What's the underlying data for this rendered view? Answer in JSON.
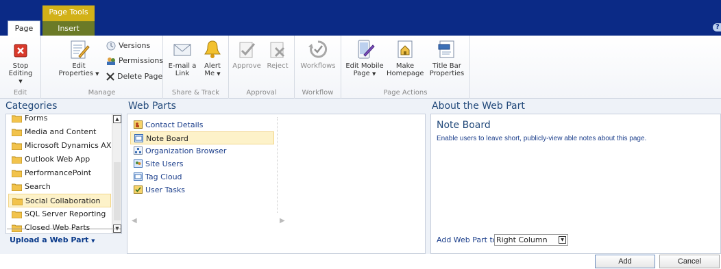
{
  "ribbon_tabs": {
    "context_group": "Page Tools",
    "page_tab": "Page",
    "insert_tab": "Insert"
  },
  "ribbon": {
    "edit": {
      "stop_editing": "Stop Editing",
      "group_label": "Edit"
    },
    "manage": {
      "edit_properties_line1": "Edit",
      "edit_properties_line2": "Properties",
      "versions": "Versions",
      "permissions": "Permissions",
      "delete_page": "Delete Page",
      "group_label": "Manage"
    },
    "share_track": {
      "email_line1": "E-mail a",
      "email_line2": "Link",
      "alert_line1": "Alert",
      "alert_line2": "Me",
      "group_label": "Share & Track"
    },
    "approval": {
      "approve": "Approve",
      "reject": "Reject",
      "group_label": "Approval"
    },
    "workflow": {
      "workflows": "Workflows",
      "group_label": "Workflow"
    },
    "page_actions": {
      "edit_mobile_line1": "Edit Mobile",
      "edit_mobile_line2": "Page",
      "make_homepage_line1": "Make",
      "make_homepage_line2": "Homepage",
      "title_bar_line1": "Title Bar",
      "title_bar_line2": "Properties",
      "group_label": "Page Actions"
    }
  },
  "categories": {
    "title": "Categories",
    "items": [
      {
        "label": "Forms"
      },
      {
        "label": "Media and Content"
      },
      {
        "label": "Microsoft Dynamics AX"
      },
      {
        "label": "Outlook Web App"
      },
      {
        "label": "PerformancePoint"
      },
      {
        "label": "Search"
      },
      {
        "label": "Social Collaboration"
      },
      {
        "label": "SQL Server Reporting"
      },
      {
        "label": "Closed Web Parts"
      }
    ],
    "selected": "Social Collaboration",
    "upload_link": "Upload a Web Part"
  },
  "web_parts": {
    "title": "Web Parts",
    "items": [
      {
        "label": "Contact Details"
      },
      {
        "label": "Note Board"
      },
      {
        "label": "Organization Browser"
      },
      {
        "label": "Site Users"
      },
      {
        "label": "Tag Cloud"
      },
      {
        "label": "User Tasks"
      }
    ],
    "selected": "Note Board"
  },
  "about": {
    "title": "About the Web Part",
    "name": "Note Board",
    "description": "Enable users to leave short, publicly-view able notes about this page.",
    "add_to_label": "Add Web Part to:",
    "add_to_value": "Right Column"
  },
  "buttons": {
    "add": "Add",
    "cancel": "Cancel"
  },
  "colors": {
    "topbar": "#0b2a86",
    "context_tab": "#d2b118",
    "selected_item_bg": "#fdf2c9",
    "heading_text": "#234a7b"
  }
}
